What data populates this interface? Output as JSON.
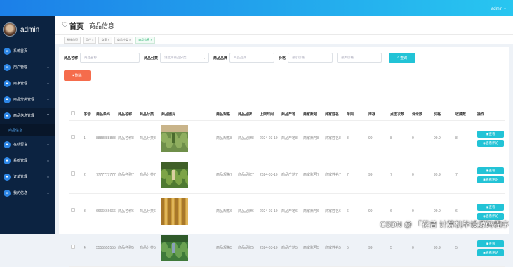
{
  "topbar": {
    "user": "admin ▾"
  },
  "sidebar": {
    "profile_name": "admin",
    "menu": [
      {
        "label": "系统首页",
        "icon": "home-icon",
        "has_chevron": false
      },
      {
        "label": "用户管理",
        "icon": "user-icon",
        "has_chevron": true
      },
      {
        "label": "商家管理",
        "icon": "store-icon",
        "has_chevron": true
      },
      {
        "label": "商品分类管理",
        "icon": "category-icon",
        "has_chevron": true
      },
      {
        "label": "商品信息管理",
        "icon": "goods-icon",
        "has_chevron": true,
        "open": true,
        "sub": [
          "商品信息"
        ]
      },
      {
        "label": "在线留言",
        "icon": "message-icon",
        "has_chevron": true
      },
      {
        "label": "系统管理",
        "icon": "system-icon",
        "has_chevron": true
      },
      {
        "label": "订单管理",
        "icon": "order-icon",
        "has_chevron": true
      },
      {
        "label": "我的信息",
        "icon": "profile-icon",
        "has_chevron": true
      }
    ]
  },
  "header": {
    "home": "首页",
    "current": "商品信息"
  },
  "tabs": [
    "系统首页",
    "用户 ×",
    "商家 ×",
    "商品分类 ×",
    "商品信息 ×"
  ],
  "search": {
    "name_label": "商品名称",
    "name_placeholder": "商品名称",
    "category_label": "商品分类",
    "category_placeholder": "请选择商品分类",
    "brand_label": "商品品牌",
    "brand_placeholder": "商品品牌",
    "price_label": "价格",
    "price_min_placeholder": "最小价格",
    "price_max_placeholder": "最大价格",
    "button": "查询"
  },
  "delete_button": "删除",
  "table": {
    "headers": [
      "",
      "序号",
      "商品条码",
      "商品名称",
      "商品分类",
      "商品图片",
      "商品规格",
      "商品品牌",
      "上架时间",
      "商品产地",
      "商家账号",
      "商家姓名",
      "单限",
      "库存",
      "点击次数",
      "评论数",
      "价格",
      "收藏数",
      "操作"
    ],
    "rows": [
      {
        "no": "1",
        "code": "8888888888",
        "name": "商品名称8",
        "category": "商品分类8",
        "spec": "商品规格8",
        "brand": "商品品牌8",
        "time": "2024-03-10",
        "origin": "商品产地8",
        "account": "商家账号8",
        "merchant": "商家姓名8",
        "limit": "8",
        "stock": "99",
        "clicks": "8",
        "comments": "0",
        "price": "99.9",
        "favs": "8",
        "op1": "查看",
        "op2": "查看评论"
      },
      {
        "no": "2",
        "code": "7777777777",
        "name": "商品名称7",
        "category": "商品分类7",
        "spec": "商品规格7",
        "brand": "商品品牌7",
        "time": "2024-03-10",
        "origin": "商品产地7",
        "account": "商家账号7",
        "merchant": "商家姓名7",
        "limit": "7",
        "stock": "99",
        "clicks": "7",
        "comments": "0",
        "price": "99.9",
        "favs": "7",
        "op1": "查看",
        "op2": "查看评论"
      },
      {
        "no": "3",
        "code": "6666666666",
        "name": "商品名称6",
        "category": "商品分类6",
        "spec": "商品规格6",
        "brand": "商品品牌6",
        "time": "2024-03-10",
        "origin": "商品产地6",
        "account": "商家账号6",
        "merchant": "商家姓名6",
        "limit": "6",
        "stock": "99",
        "clicks": "6",
        "comments": "0",
        "price": "99.9",
        "favs": "6",
        "op1": "查看",
        "op2": "查看评论"
      },
      {
        "no": "4",
        "code": "5555555555",
        "name": "商品名称5",
        "category": "商品分类5",
        "spec": "商品规格5",
        "brand": "商品品牌5",
        "time": "2024-03-10",
        "origin": "商品产地5",
        "account": "商家账号5",
        "merchant": "商家姓名5",
        "limit": "5",
        "stock": "99",
        "clicks": "5",
        "comments": "0",
        "price": "99.9",
        "favs": "5",
        "op1": "查看",
        "op2": "查看评论"
      }
    ]
  },
  "watermark": "CSDN @ 「花昔 计算机毕设源码程序"
}
